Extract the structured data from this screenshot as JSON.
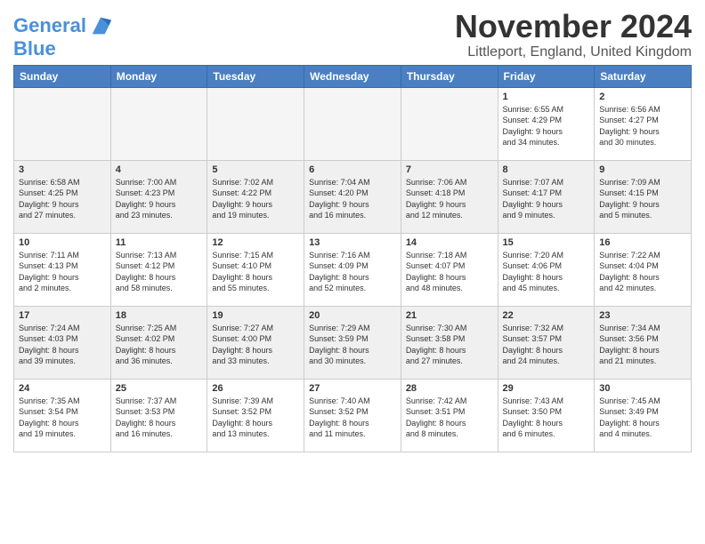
{
  "logo": {
    "line1": "General",
    "line2": "Blue"
  },
  "title": "November 2024",
  "location": "Littleport, England, United Kingdom",
  "days_of_week": [
    "Sunday",
    "Monday",
    "Tuesday",
    "Wednesday",
    "Thursday",
    "Friday",
    "Saturday"
  ],
  "weeks": [
    [
      {
        "num": "",
        "info": "",
        "empty": true
      },
      {
        "num": "",
        "info": "",
        "empty": true
      },
      {
        "num": "",
        "info": "",
        "empty": true
      },
      {
        "num": "",
        "info": "",
        "empty": true
      },
      {
        "num": "",
        "info": "",
        "empty": true
      },
      {
        "num": "1",
        "info": "Sunrise: 6:55 AM\nSunset: 4:29 PM\nDaylight: 9 hours\nand 34 minutes."
      },
      {
        "num": "2",
        "info": "Sunrise: 6:56 AM\nSunset: 4:27 PM\nDaylight: 9 hours\nand 30 minutes."
      }
    ],
    [
      {
        "num": "3",
        "info": "Sunrise: 6:58 AM\nSunset: 4:25 PM\nDaylight: 9 hours\nand 27 minutes."
      },
      {
        "num": "4",
        "info": "Sunrise: 7:00 AM\nSunset: 4:23 PM\nDaylight: 9 hours\nand 23 minutes."
      },
      {
        "num": "5",
        "info": "Sunrise: 7:02 AM\nSunset: 4:22 PM\nDaylight: 9 hours\nand 19 minutes."
      },
      {
        "num": "6",
        "info": "Sunrise: 7:04 AM\nSunset: 4:20 PM\nDaylight: 9 hours\nand 16 minutes."
      },
      {
        "num": "7",
        "info": "Sunrise: 7:06 AM\nSunset: 4:18 PM\nDaylight: 9 hours\nand 12 minutes."
      },
      {
        "num": "8",
        "info": "Sunrise: 7:07 AM\nSunset: 4:17 PM\nDaylight: 9 hours\nand 9 minutes."
      },
      {
        "num": "9",
        "info": "Sunrise: 7:09 AM\nSunset: 4:15 PM\nDaylight: 9 hours\nand 5 minutes."
      }
    ],
    [
      {
        "num": "10",
        "info": "Sunrise: 7:11 AM\nSunset: 4:13 PM\nDaylight: 9 hours\nand 2 minutes."
      },
      {
        "num": "11",
        "info": "Sunrise: 7:13 AM\nSunset: 4:12 PM\nDaylight: 8 hours\nand 58 minutes."
      },
      {
        "num": "12",
        "info": "Sunrise: 7:15 AM\nSunset: 4:10 PM\nDaylight: 8 hours\nand 55 minutes."
      },
      {
        "num": "13",
        "info": "Sunrise: 7:16 AM\nSunset: 4:09 PM\nDaylight: 8 hours\nand 52 minutes."
      },
      {
        "num": "14",
        "info": "Sunrise: 7:18 AM\nSunset: 4:07 PM\nDaylight: 8 hours\nand 48 minutes."
      },
      {
        "num": "15",
        "info": "Sunrise: 7:20 AM\nSunset: 4:06 PM\nDaylight: 8 hours\nand 45 minutes."
      },
      {
        "num": "16",
        "info": "Sunrise: 7:22 AM\nSunset: 4:04 PM\nDaylight: 8 hours\nand 42 minutes."
      }
    ],
    [
      {
        "num": "17",
        "info": "Sunrise: 7:24 AM\nSunset: 4:03 PM\nDaylight: 8 hours\nand 39 minutes."
      },
      {
        "num": "18",
        "info": "Sunrise: 7:25 AM\nSunset: 4:02 PM\nDaylight: 8 hours\nand 36 minutes."
      },
      {
        "num": "19",
        "info": "Sunrise: 7:27 AM\nSunset: 4:00 PM\nDaylight: 8 hours\nand 33 minutes."
      },
      {
        "num": "20",
        "info": "Sunrise: 7:29 AM\nSunset: 3:59 PM\nDaylight: 8 hours\nand 30 minutes."
      },
      {
        "num": "21",
        "info": "Sunrise: 7:30 AM\nSunset: 3:58 PM\nDaylight: 8 hours\nand 27 minutes."
      },
      {
        "num": "22",
        "info": "Sunrise: 7:32 AM\nSunset: 3:57 PM\nDaylight: 8 hours\nand 24 minutes."
      },
      {
        "num": "23",
        "info": "Sunrise: 7:34 AM\nSunset: 3:56 PM\nDaylight: 8 hours\nand 21 minutes."
      }
    ],
    [
      {
        "num": "24",
        "info": "Sunrise: 7:35 AM\nSunset: 3:54 PM\nDaylight: 8 hours\nand 19 minutes."
      },
      {
        "num": "25",
        "info": "Sunrise: 7:37 AM\nSunset: 3:53 PM\nDaylight: 8 hours\nand 16 minutes."
      },
      {
        "num": "26",
        "info": "Sunrise: 7:39 AM\nSunset: 3:52 PM\nDaylight: 8 hours\nand 13 minutes."
      },
      {
        "num": "27",
        "info": "Sunrise: 7:40 AM\nSunset: 3:52 PM\nDaylight: 8 hours\nand 11 minutes."
      },
      {
        "num": "28",
        "info": "Sunrise: 7:42 AM\nSunset: 3:51 PM\nDaylight: 8 hours\nand 8 minutes."
      },
      {
        "num": "29",
        "info": "Sunrise: 7:43 AM\nSunset: 3:50 PM\nDaylight: 8 hours\nand 6 minutes."
      },
      {
        "num": "30",
        "info": "Sunrise: 7:45 AM\nSunset: 3:49 PM\nDaylight: 8 hours\nand 4 minutes."
      }
    ]
  ]
}
